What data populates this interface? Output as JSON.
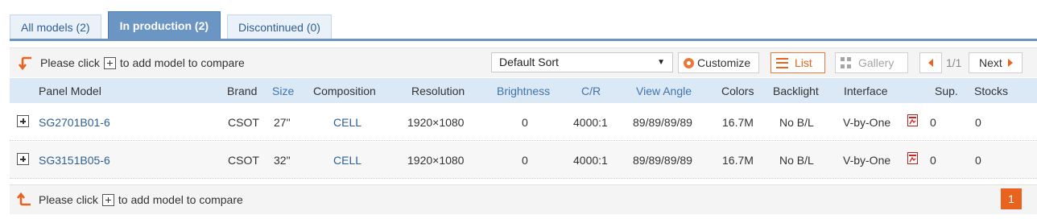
{
  "tabs": [
    {
      "label": "All models (2)"
    },
    {
      "label": "In production (2)"
    },
    {
      "label": "Discontinued (0)"
    }
  ],
  "toolbar": {
    "hint_before": "Please click",
    "hint_after": "to add model to compare",
    "sort_value": "Default Sort",
    "customize_label": "Customize",
    "list_label": "List",
    "gallery_label": "Gallery",
    "page_info": "1/1",
    "next_label": "Next"
  },
  "columns": [
    "Panel Model",
    "Brand",
    "Size",
    "Composition",
    "Resolution",
    "Brightness",
    "C/R",
    "View Angle",
    "Colors",
    "Backlight",
    "Interface",
    "Sup.",
    "Stocks"
  ],
  "rows": [
    {
      "model": "SG2701B01-6",
      "brand": "CSOT",
      "size": "27\"",
      "composition": "CELL",
      "resolution": "1920×1080",
      "brightness": "0",
      "cr": "4000:1",
      "view_angle": "89/89/89/89",
      "colors": "16.7M",
      "backlight": "No B/L",
      "interface": "V-by-One",
      "sup": "0",
      "stocks": "0"
    },
    {
      "model": "SG3151B05-6",
      "brand": "CSOT",
      "size": "32\"",
      "composition": "CELL",
      "resolution": "1920×1080",
      "brightness": "0",
      "cr": "4000:1",
      "view_angle": "89/89/89/89",
      "colors": "16.7M",
      "backlight": "No B/L",
      "interface": "V-by-One",
      "sup": "0",
      "stocks": "0"
    }
  ],
  "footer": {
    "hint_before": "Please click",
    "hint_after": "to add model to compare",
    "current_page": "1"
  },
  "colors": {
    "accent": "#e8641e",
    "tab_active": "#6b96c4",
    "header_bg": "#dbe8f5",
    "link": "#2d5f93"
  }
}
